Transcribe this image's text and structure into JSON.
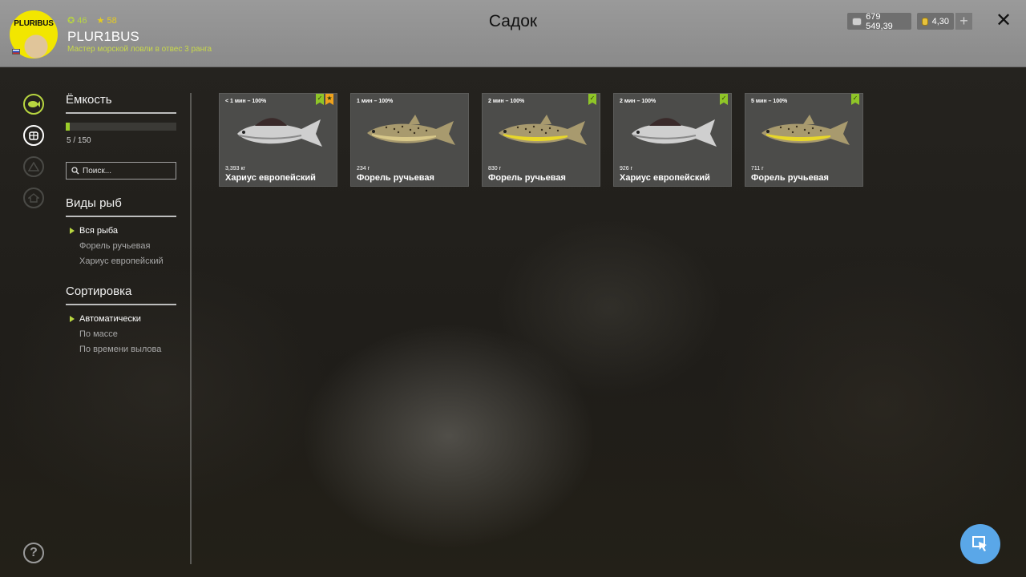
{
  "header": {
    "avatar_text": "PLURIBUS",
    "stats": {
      "level": "46",
      "rating": "58"
    },
    "username": "PLUR1BUS",
    "rank": "Мастер морской ловли в отвес 3 ранга",
    "title": "Садок",
    "silver": "679 549,39",
    "gold": "4,30",
    "plus_label": "+",
    "close_label": "✕"
  },
  "rail": {
    "icons": [
      "fish-icon",
      "keepnet-icon",
      "camp-icon",
      "home-icon"
    ],
    "help_label": "?"
  },
  "capacity": {
    "title": "Ёмкость",
    "text": "5 / 150",
    "fill_fraction": 0.0333
  },
  "search": {
    "placeholder": "Поиск..."
  },
  "species": {
    "title": "Виды рыб",
    "items": [
      "Вся рыба",
      "Форель ручьевая",
      "Хариус европейский"
    ]
  },
  "sorting": {
    "title": "Сортировка",
    "items": [
      "Автоматически",
      "По массе",
      "По времени вылова"
    ]
  },
  "cards": [
    {
      "time": "< 1 мин – 100%",
      "weight": "3,393 кг",
      "name": "Хариус европейский",
      "badges": [
        "green",
        "orange"
      ]
    },
    {
      "time": "1 мин – 100%",
      "weight": "234 г",
      "name": "Форель ручьевая",
      "badges": []
    },
    {
      "time": "2 мин – 100%",
      "weight": "830 г",
      "name": "Форель ручьевая",
      "badges": [
        "green"
      ]
    },
    {
      "time": "2 мин – 100%",
      "weight": "926 г",
      "name": "Хариус европейский",
      "badges": [
        "green"
      ]
    },
    {
      "time": "5 мин – 100%",
      "weight": "711 г",
      "name": "Форель ручьевая",
      "badges": [
        "green"
      ]
    }
  ],
  "colors": {
    "accent": "#b8d640",
    "badge_green": "#8fc528",
    "badge_orange": "#f0a21c",
    "cursor_button": "#5aa7e8"
  }
}
